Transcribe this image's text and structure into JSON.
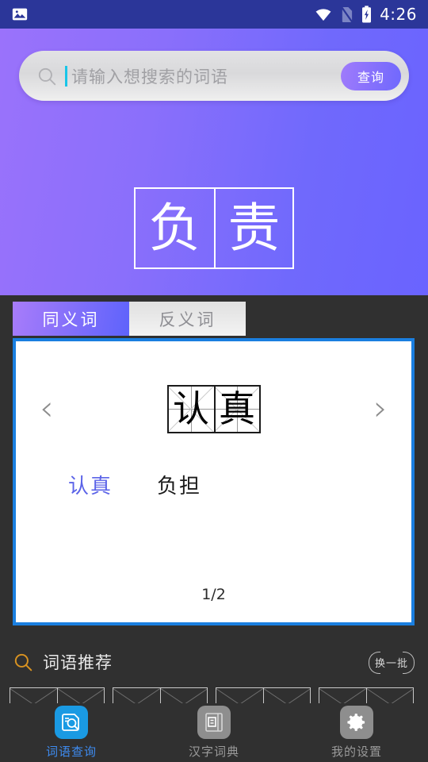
{
  "statusbar": {
    "time": "4:26",
    "icons": [
      "image-icon",
      "wifi-icon",
      "no-sim-icon",
      "battery-charging-icon"
    ]
  },
  "search": {
    "placeholder": "请输入想搜索的词语",
    "value": "",
    "button_label": "查询",
    "icon": "search-icon"
  },
  "headword": {
    "chars": [
      "负",
      "责"
    ],
    "text": "负责"
  },
  "tabs": [
    {
      "label": "同义词",
      "active": true
    },
    {
      "label": "反义词",
      "active": false
    }
  ],
  "card": {
    "prev_arrow": "‹",
    "next_arrow": "›",
    "current_word_chars": [
      "认",
      "真"
    ],
    "current_word": "认真",
    "words": [
      {
        "text": "认真",
        "selected": true
      },
      {
        "text": "负担",
        "selected": false
      }
    ],
    "pagination": "1/2",
    "border_color": "#1a7fe0"
  },
  "recommend": {
    "icon": "search-icon",
    "icon_color": "#d99321",
    "title": "词语推荐",
    "refresh_label": "换一批",
    "cells": 4
  },
  "bottomnav": [
    {
      "label": "词语查询",
      "icon": "dictionary-search-icon",
      "active": true,
      "color": "#1a9ae3"
    },
    {
      "label": "汉字词典",
      "icon": "book-icon",
      "active": false,
      "color": "#8e8e8e"
    },
    {
      "label": "我的设置",
      "icon": "gear-icon",
      "active": false,
      "color": "#8e8e8e"
    }
  ],
  "theme": {
    "statusbar_bg": "#2b3699",
    "hero_from": "#9a72fb",
    "hero_to": "#6a63ff",
    "page_bg": "#303030",
    "accent_blue": "#1a7fe0",
    "selected_word": "#5b63e8"
  }
}
